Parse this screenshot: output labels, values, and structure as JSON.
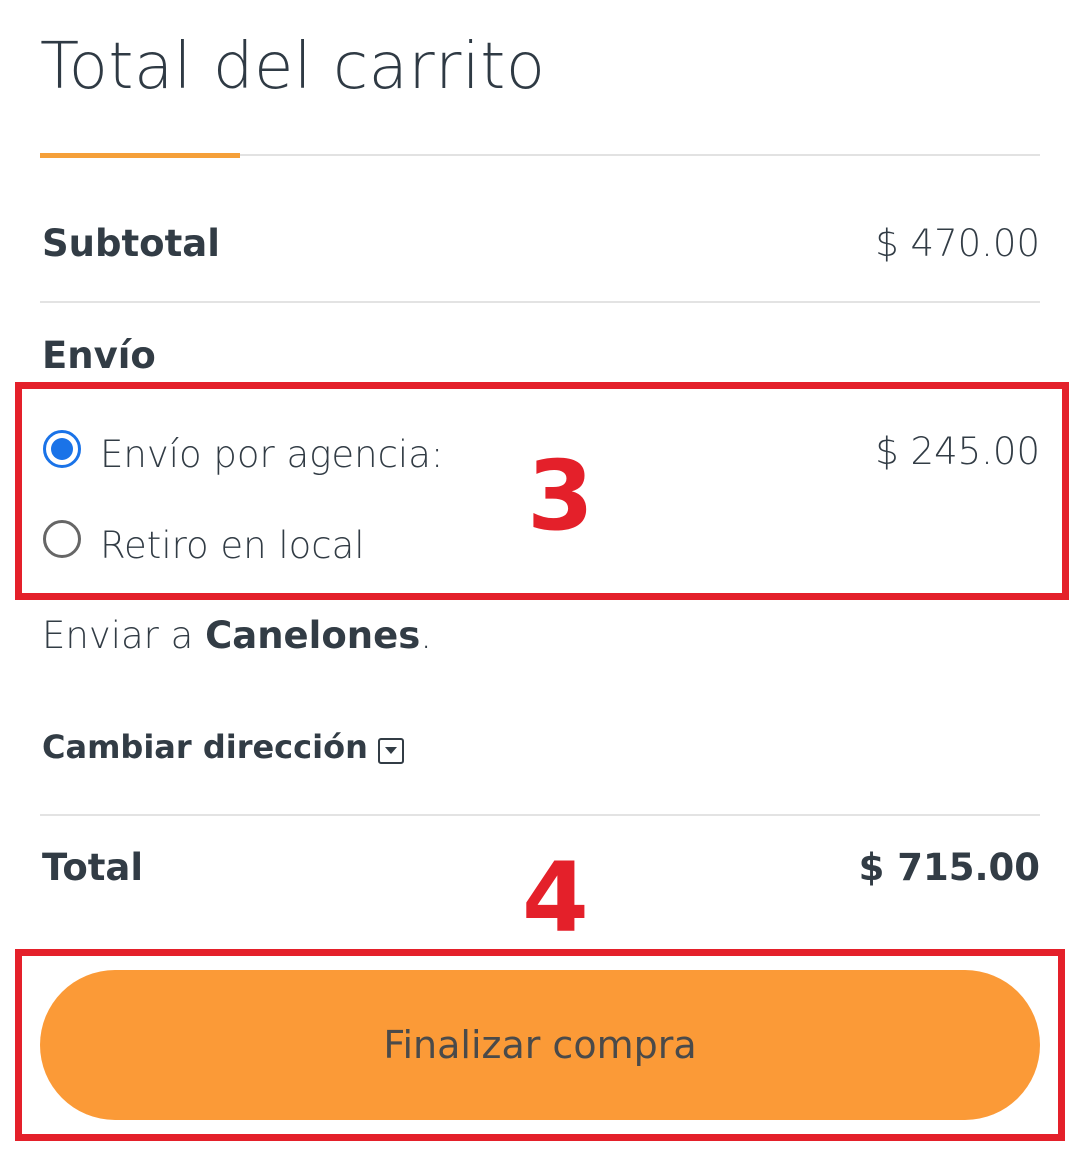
{
  "cart": {
    "title": "Total del carrito",
    "subtotal_label": "Subtotal",
    "subtotal_value": "$ 470.00",
    "shipping_label": "Envío",
    "shipping_options": [
      {
        "label": "Envío por agencia:",
        "price": "$ 245.00",
        "selected": true
      },
      {
        "label": "Retiro en local",
        "price": "",
        "selected": false
      }
    ],
    "ship_to_prefix": "Enviar a ",
    "ship_to_city": "Canelones",
    "ship_to_suffix": ".",
    "change_address": "Cambiar dirección",
    "total_label": "Total",
    "total_value": "$ 715.00",
    "checkout_button": "Finalizar compra"
  },
  "annotations": {
    "step3": "3",
    "step4": "4",
    "color": "#e4202a"
  },
  "colors": {
    "accent": "#f5a03a",
    "button": "#fb9a37",
    "radio": "#1a73e8",
    "text": "#323c45"
  },
  "icons": {
    "change_address": "caret-down-box-icon"
  }
}
